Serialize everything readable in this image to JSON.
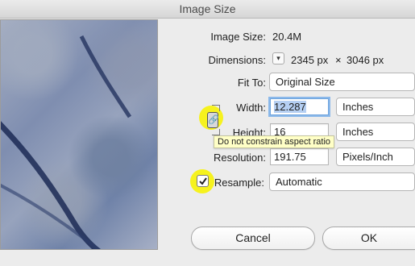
{
  "window": {
    "title": "Image Size"
  },
  "info": {
    "image_size_label": "Image Size:",
    "image_size_value": "20.4M",
    "dimensions_label": "Dimensions:",
    "dimensions_width": "2345 px",
    "dimensions_times": "×",
    "dimensions_height": "3046 px"
  },
  "fit_to": {
    "label": "Fit To:",
    "value": "Original Size"
  },
  "width": {
    "label": "Width:",
    "value": "12.287",
    "unit": "Inches"
  },
  "height": {
    "label": "Height:",
    "value": "16",
    "unit": "Inches"
  },
  "resolution": {
    "label": "Resolution:",
    "value": "191.75",
    "unit": "Pixels/Inch"
  },
  "resample": {
    "label": "Resample:",
    "value": "Automatic",
    "checked": true
  },
  "tooltip": {
    "text": "Do not constrain aspect ratio"
  },
  "buttons": {
    "cancel": "Cancel",
    "ok": "OK"
  },
  "icons": {
    "dimensions_menu": "chevron-down-icon",
    "constrain": "link-chain-icon",
    "cursor": "arrow-cursor-icon",
    "resample_check": "checkmark-icon"
  },
  "colors": {
    "highlight": "#f6f21e",
    "focus_ring": "#8cb9ea",
    "tooltip_bg": "#ffffc6"
  }
}
